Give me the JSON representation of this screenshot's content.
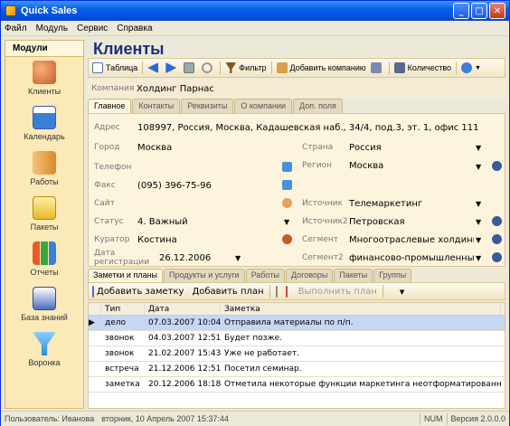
{
  "window": {
    "title": "Quick Sales",
    "min": "_",
    "max": "□",
    "close": "✕"
  },
  "menu": [
    "Файл",
    "Модуль",
    "Сервис",
    "Справка"
  ],
  "sidebar": {
    "header": "Модули",
    "items": [
      {
        "label": "Клиенты",
        "icon": "clients-icon",
        "color": "#c85a2a"
      },
      {
        "label": "Календарь",
        "icon": "calendar-icon",
        "color": "#3a7fd8"
      },
      {
        "label": "Работы",
        "icon": "works-icon",
        "color": "#d88a2a"
      },
      {
        "label": "Пакеты",
        "icon": "packages-icon",
        "color": "#e8b82a"
      },
      {
        "label": "Отчеты",
        "icon": "reports-icon",
        "color": "#3aa83a"
      },
      {
        "label": "База знаний",
        "icon": "knowledge-icon",
        "color": "#4a6fc0"
      },
      {
        "label": "Воронка",
        "icon": "funnel-icon",
        "color": "#2a8ad8"
      }
    ]
  },
  "page": {
    "title": "Клиенты"
  },
  "toolbar": {
    "table": "Таблица",
    "filter": "Фильтр",
    "add_company": "Добавить компанию",
    "count": "Количество"
  },
  "company": {
    "label": "Компания",
    "value": "Холдинг Парнас"
  },
  "tabs": [
    "Главное",
    "Контакты",
    "Реквизиты",
    "О компании",
    "Доп. поля"
  ],
  "form": {
    "address_label": "Адрес",
    "address": "108997, Россия, Москва, Кадашевская наб., 34/4, под.3, эт. 1, офис 111",
    "city_label": "Город",
    "city": "Москва",
    "country_label": "Страна",
    "country": "Россия",
    "phone_label": "Телефон",
    "phone": "",
    "region_label": "Регион",
    "region": "Москва",
    "fax_label": "Факс",
    "fax": "(095) 396-75-96",
    "site_label": "Сайт",
    "site": "",
    "source_label": "Источник",
    "source": "Телемаркетинг",
    "status_label": "Статус",
    "status": "4. Важный",
    "source2_label": "Источник2",
    "source2": "Петровская",
    "curator_label": "Куратор",
    "curator": "Костина",
    "segment_label": "Сегмент",
    "segment": "Многоотраслевые холдинги",
    "regdate_label": "Дата регистрации",
    "regdate": "26.12.2006",
    "segment2_label": "Сегмент2",
    "segment2": "финансово-промышленные"
  },
  "bottom_tabs": [
    "Заметки и планы",
    "Продукты и услуги",
    "Работы",
    "Договоры",
    "Пакеты",
    "Группы"
  ],
  "bottom_toolbar": {
    "add_note": "Добавить заметку",
    "add_plan": "Добавить план",
    "execute_plan": "Выполнить план"
  },
  "grid": {
    "headers": [
      "Тип",
      "Дата",
      "Заметка"
    ],
    "rows": [
      {
        "type": "дело",
        "date": "07.03.2007 10:04",
        "note": "Отправила материалы по п/п."
      },
      {
        "type": "звонок",
        "date": "04.03.2007 12:51",
        "note": "Будет позже."
      },
      {
        "type": "звонок",
        "date": "21.02.2007 15:43",
        "note": "Уже не работает."
      },
      {
        "type": "встреча",
        "date": "21.12.2006 12:51",
        "note": "Посетил семинар."
      },
      {
        "type": "заметка",
        "date": "20.12.2006 18:18",
        "note": "Отметила некоторые функции маркетинга неотформатированные и дала курс"
      }
    ]
  },
  "status": {
    "user": "Пользователь: Иванова",
    "datetime": "вторник, 10 Апрель 2007 15:37:44",
    "num": "NUM",
    "version": "Версия 2.0.0.0"
  }
}
